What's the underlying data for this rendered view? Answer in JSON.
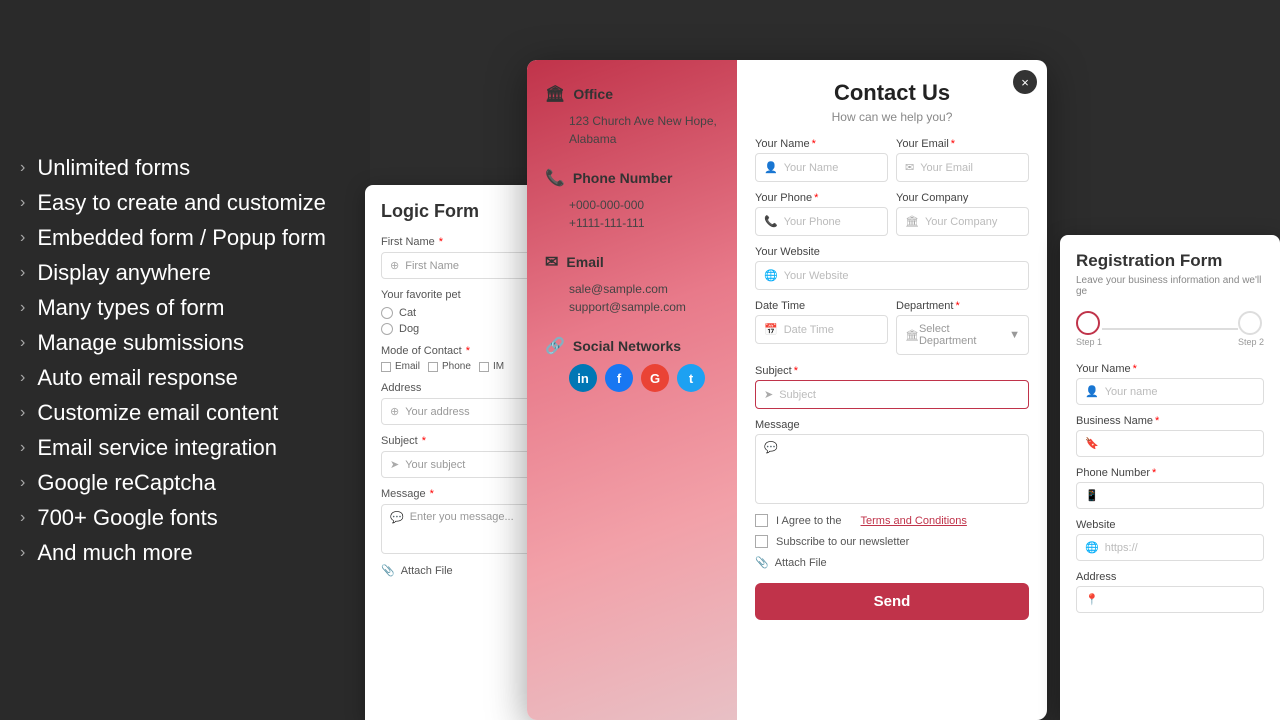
{
  "leftPanel": {
    "features": [
      "Unlimited forms",
      "Easy to create and customize",
      "Embedded form / Popup form",
      "Display anywhere",
      "Many types of form",
      "Manage submissions",
      "Auto email response",
      "Customize email content",
      "Email service integration",
      "Google reCaptcha",
      "700+ Google fonts",
      "And much more"
    ]
  },
  "logicForm": {
    "title": "Logic Form",
    "firstNameLabel": "First Name",
    "firstNameReq": "*",
    "firstNamePlaceholder": "First Name",
    "petLabel": "Your favorite pet",
    "petOptions": [
      "Cat",
      "Dog"
    ],
    "modeLabel": "Mode of Contact",
    "modeReq": "*",
    "modeOptions": [
      "Email",
      "Phone",
      "IM"
    ],
    "addressLabel": "Address",
    "addressPlaceholder": "Your address",
    "subjectLabel": "Subject",
    "subjectReq": "*",
    "subjectPlaceholder": "Your subject",
    "messageLabel": "Message",
    "messageReq": "*",
    "messagePlaceholder": "Enter you message...",
    "attachLabel": "Attach File"
  },
  "contactModal": {
    "title": "Contact Us",
    "subtitle": "How can we help you?",
    "closeLabel": "×",
    "leftInfo": {
      "officeTitle": "Office",
      "officeIcon": "🏛",
      "officeAddress": "123 Church Ave New Hope, Alabama",
      "phoneTitle": "Phone Number",
      "phoneIcon": "📞",
      "phoneNumbers": [
        "+000-000-000",
        "+1111-111-111"
      ],
      "emailTitle": "Email",
      "emailIcon": "✉",
      "emails": [
        "sale@sample.com",
        "support@sample.com"
      ],
      "socialTitle": "Social Networks",
      "socialIcon": "🔗",
      "socialButtons": [
        {
          "name": "linkedin",
          "label": "in",
          "class": "social-linkedin"
        },
        {
          "name": "facebook",
          "label": "f",
          "class": "social-facebook"
        },
        {
          "name": "google",
          "label": "G",
          "class": "social-google"
        },
        {
          "name": "twitter",
          "label": "t",
          "class": "social-twitter"
        }
      ]
    },
    "fields": {
      "yourName": "Your Name",
      "yourNameReq": "*",
      "yourNamePlaceholder": "Your Name",
      "yourEmail": "Your Email",
      "yourEmailReq": "*",
      "yourEmailPlaceholder": "Your Email",
      "yourPhone": "Your Phone",
      "yourPhoneReq": "*",
      "yourPhonePlaceholder": "Your Phone",
      "yourCompany": "Your Company",
      "yourCompanyPlaceholder": "Your Company",
      "yourWebsite": "Your Website",
      "yourWebsitePlaceholder": "Your Website",
      "dateTime": "Date Time",
      "dateTimePlaceholder": "Date Time",
      "department": "Department",
      "departmentReq": "*",
      "departmentPlaceholder": "Select Department",
      "subject": "Subject",
      "subjectReq": "*",
      "subjectPlaceholder": "Subject",
      "message": "Message",
      "messagePlaceholder": "",
      "termsText": "I Agree to the",
      "termsLink": "Terms and Conditions",
      "newsletterText": "Subscribe to our newsletter",
      "attachText": "Attach File",
      "sendButton": "Send"
    }
  },
  "registrationForm": {
    "title": "Registration Form",
    "subtitle": "Leave your business information and we'll ge",
    "step1Label": "Step 1",
    "step2Label": "Step 2",
    "fields": {
      "yourName": "Your Name",
      "yourNameReq": "*",
      "yourNamePlaceholder": "Your name",
      "businessName": "Business Name",
      "businessNameReq": "*",
      "businessNamePlaceholder": "",
      "phoneNumber": "Phone Number",
      "phoneNumberReq": "*",
      "phoneNumberPlaceholder": "",
      "website": "Website",
      "websitePlaceholder": "https://",
      "address": "Address",
      "addressPlaceholder": ""
    }
  }
}
